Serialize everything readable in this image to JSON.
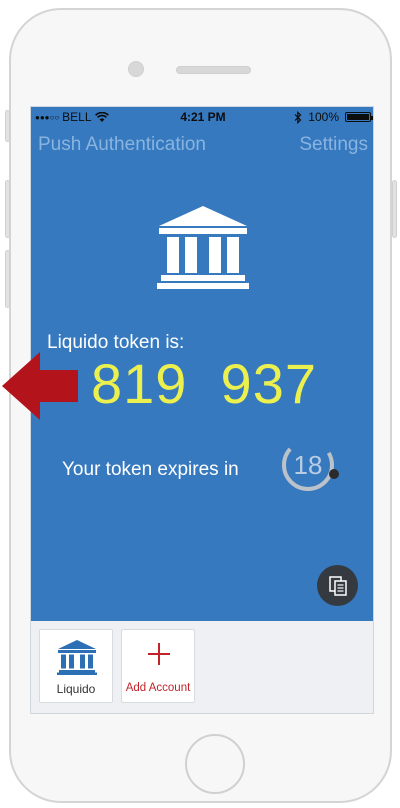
{
  "status_bar": {
    "signal_dots": "●●●○○",
    "carrier": "BELL",
    "time": "4:21 PM",
    "battery": "100%",
    "battery_level": 1.0,
    "icons": [
      "wifi-icon",
      "bluetooth-icon",
      "battery-icon"
    ]
  },
  "nav": {
    "title": "Push Authentication",
    "settings": "Settings"
  },
  "token": {
    "label": "Liquido token is:",
    "value": "819  937",
    "expires_label": "Your token expires in",
    "seconds_remaining": "18",
    "countdown_fraction": 0.3
  },
  "accounts": [
    {
      "label": "Liquido",
      "icon": "bank-icon"
    },
    {
      "label": "Add Account",
      "icon": "plus-icon"
    }
  ],
  "colors": {
    "app_background": "#3679bf",
    "token_value": "#ecf04f",
    "nav_text": "#89b4e0",
    "add_account_accent": "#c0242a",
    "pointer_arrow": "#b3141b",
    "copy_button": "#343a40"
  }
}
